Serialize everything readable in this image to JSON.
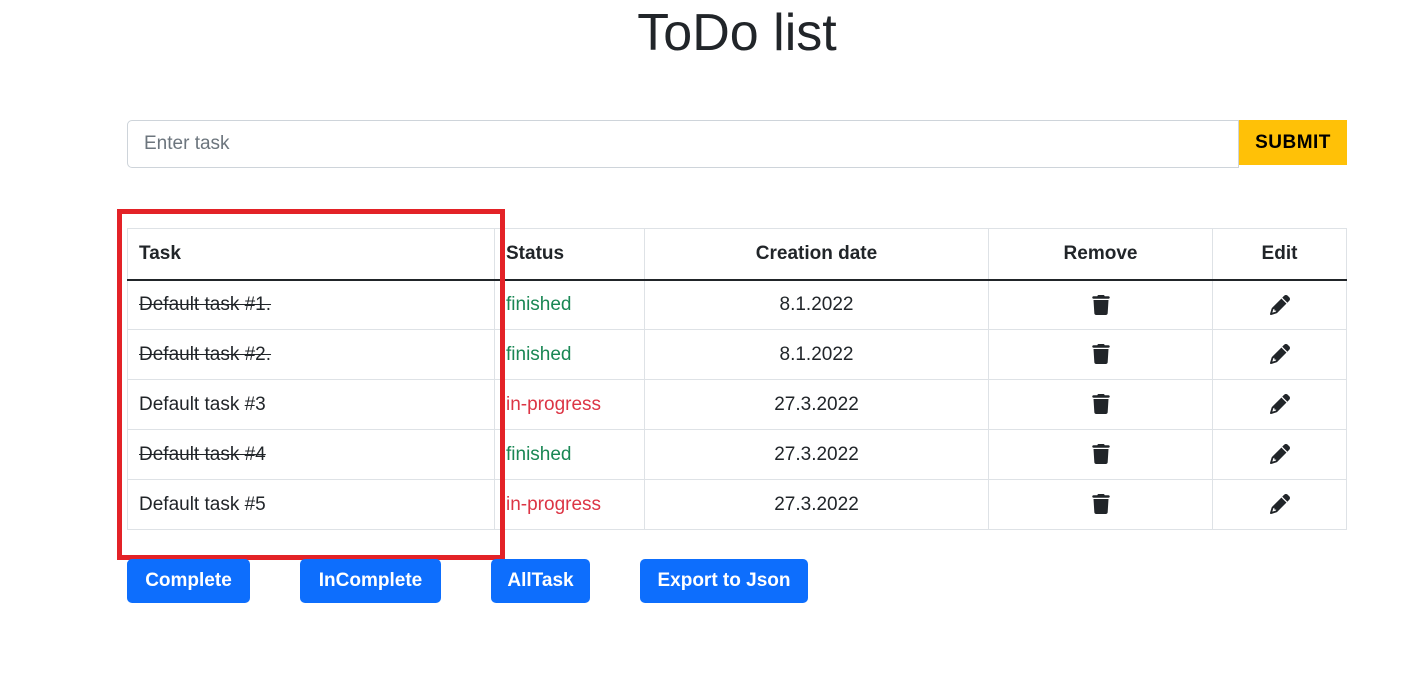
{
  "header": {
    "title": "ToDo list"
  },
  "form": {
    "placeholder": "Enter task",
    "value": "",
    "submit_label": "SUBMIT"
  },
  "table": {
    "columns": {
      "task": "Task",
      "status": "Status",
      "date": "Creation date",
      "remove": "Remove",
      "edit": "Edit"
    },
    "rows": [
      {
        "task": "Default task #1.",
        "status": "finished",
        "date": "8.1.2022",
        "done": true
      },
      {
        "task": "Default task #2.",
        "status": "finished",
        "date": "8.1.2022",
        "done": true
      },
      {
        "task": "Default task #3",
        "status": "in-progress",
        "date": "27.3.2022",
        "done": false
      },
      {
        "task": "Default task #4",
        "status": "finished",
        "date": "27.3.2022",
        "done": true
      },
      {
        "task": "Default task #5",
        "status": "in-progress",
        "date": "27.3.2022",
        "done": false
      }
    ],
    "remove_icon": "trash-icon",
    "edit_icon": "pencil-icon"
  },
  "buttons": {
    "complete": "Complete",
    "incomplete": "InComplete",
    "all": "AllTask",
    "export": "Export to Json"
  },
  "colors": {
    "submit": "#ffc107",
    "primary": "#0d6efd",
    "finished": "#198754",
    "in_progress": "#dc3545",
    "highlight": "#e32227"
  }
}
